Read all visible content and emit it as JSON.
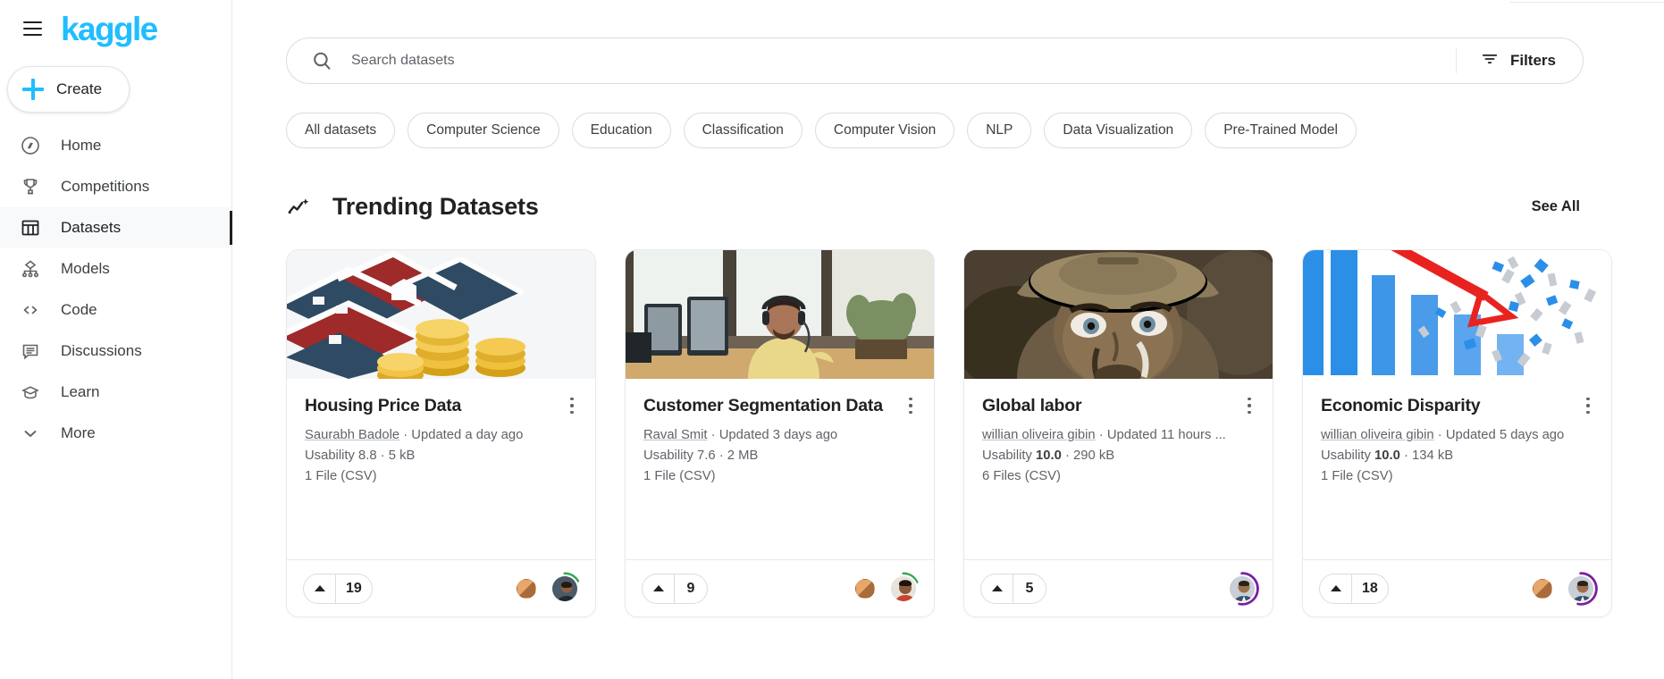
{
  "brand": {
    "name": "kaggle",
    "color": "#20beff"
  },
  "sidebar": {
    "create_label": "Create",
    "items": [
      {
        "label": "Home",
        "icon": "compass-icon"
      },
      {
        "label": "Competitions",
        "icon": "trophy-icon"
      },
      {
        "label": "Datasets",
        "icon": "table-icon"
      },
      {
        "label": "Models",
        "icon": "model-tree-icon"
      },
      {
        "label": "Code",
        "icon": "code-brackets-icon"
      },
      {
        "label": "Discussions",
        "icon": "comment-icon"
      },
      {
        "label": "Learn",
        "icon": "graduation-cap-icon"
      },
      {
        "label": "More",
        "icon": "chevron-down-icon"
      }
    ],
    "active_item": "Datasets"
  },
  "search": {
    "placeholder": "Search datasets",
    "value": "",
    "icon": "search-icon",
    "filters_label": "Filters",
    "filters_icon": "filter-icon"
  },
  "chips": [
    "All datasets",
    "Computer Science",
    "Education",
    "Classification",
    "Computer Vision",
    "NLP",
    "Data Visualization",
    "Pre-Trained Model"
  ],
  "section": {
    "title": "Trending Datasets",
    "icon": "trending-sparkline-icon",
    "see_all_label": "See All"
  },
  "cards": [
    {
      "title": "Housing Price Data",
      "author": "Saurabh Badole",
      "updated": "Updated a day ago",
      "usability_label": "Usability",
      "usability": "8.8",
      "usability_bold": false,
      "size": "5 kB",
      "files": "1 File (CSV)",
      "votes": "19",
      "medal": "bronze",
      "ring_color": "#34a853",
      "truncated": false,
      "thumb": "house-model-with-gold-coins"
    },
    {
      "title": "Customer Segmentation Data",
      "author": "Raval Smit",
      "updated": "Updated 3 days ago",
      "usability_label": "Usability",
      "usability": "7.6",
      "usability_bold": false,
      "size": "2 MB",
      "files": "1 File (CSV)",
      "votes": "9",
      "medal": "bronze",
      "ring_color": "#34a853",
      "truncated": false,
      "thumb": "man-with-headset-at-desk"
    },
    {
      "title": "Global labor",
      "author": "willian oliveira gibin",
      "updated": "Updated 11 hours ...",
      "usability_label": "Usability",
      "usability": "10.0",
      "usability_bold": true,
      "size": "290 kB",
      "files": "6 Files (CSV)",
      "votes": "5",
      "medal": "none",
      "ring_color": "#7b1fa2",
      "truncated": true,
      "thumb": "soldier-portrait-helmet"
    },
    {
      "title": "Economic Disparity",
      "author": "willian oliveira gibin",
      "updated": "Updated 5 days ago",
      "usability_label": "Usability",
      "usability": "10.0",
      "usability_bold": true,
      "size": "134 kB",
      "files": "1 File (CSV)",
      "votes": "18",
      "medal": "bronze",
      "ring_color": "#7b1fa2",
      "truncated": false,
      "thumb": "declining-blue-bar-chart-red-arrow"
    }
  ]
}
